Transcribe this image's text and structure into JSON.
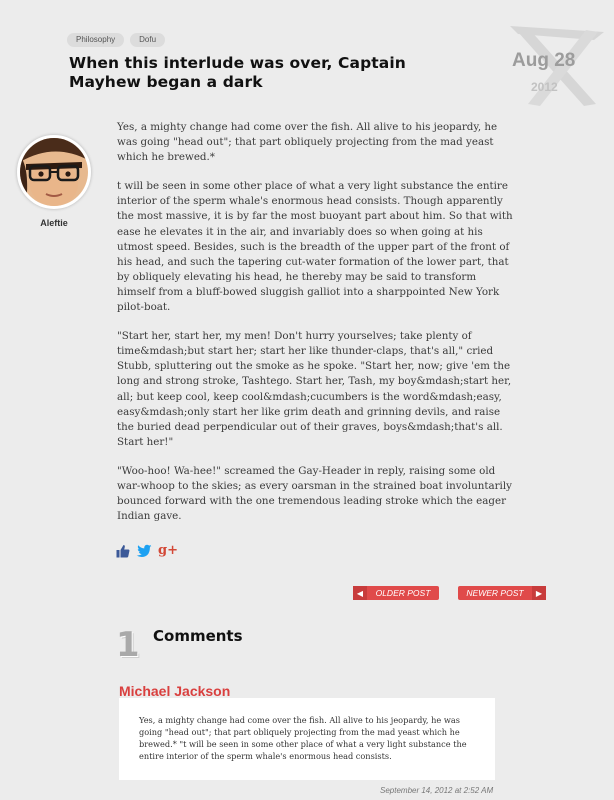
{
  "tags": [
    "Philosophy",
    "Dofu"
  ],
  "post": {
    "title": "When this interlude was over, Captain Mayhew began a dark",
    "date_day": "Aug 28",
    "date_year": "2012",
    "author": "Aleftie",
    "paragraphs": [
      "Yes, a mighty change had come over the fish. All alive to his jeopardy, he was going \"head out\"; that part obliquely projecting from the mad yeast which he brewed.*",
      "t will be seen in some other place of what a very light substance the entire interior of the sperm whale's enormous head consists. Though apparently the most massive, it is by far the most buoyant part about him. So that with ease he elevates it in the air, and invariably does so when going at his utmost speed. Besides, such is the breadth of the upper part of the front of his head, and such the tapering cut-water formation of the lower part, that by obliquely elevating his head, he thereby may be said to transform himself from a bluff-bowed sluggish galliot into a sharppointed New York pilot-boat.",
      "\"Start her, start her, my men! Don't hurry yourselves; take plenty of time&mdash;but start her; start her like thunder-claps, that's all,\" cried Stubb, spluttering out the smoke as he spoke. \"Start her, now; give 'em the long and strong stroke, Tashtego. Start her, Tash, my boy&mdash;start her, all; but keep cool, keep cool&mdash;cucumbers is the word&mdash;easy, easy&mdash;only start her like grim death and grinning devils, and raise the buried dead perpendicular out of their graves, boys&mdash;that's all. Start her!\"",
      "\"Woo-hoo! Wa-hee!\" screamed the Gay-Header in reply, raising some old war-whoop to the skies; as every oarsman in the strained boat involuntarily bounced forward with the one tremendous leading stroke which the eager Indian gave."
    ]
  },
  "share": {
    "icons": [
      "thumbs-up-icon",
      "twitter-icon",
      "google-plus-icon"
    ],
    "gplus_label": "g+"
  },
  "nav": {
    "older": "OLDER POST",
    "newer": "NEWER POST"
  },
  "comments": {
    "count": "1",
    "heading": "Comments",
    "items": [
      {
        "author": "Michael Jackson",
        "text": "Yes, a mighty change had come over the fish. All alive to his jeopardy, he was going \"head out\"; that part obliquely projecting from the mad yeast which he brewed.* \"t will be seen in some other place of what a very light substance the entire interior of the sperm whale's enormous head consists.",
        "date": "September 14, 2012 at 2:52 AM"
      }
    ]
  },
  "colors": {
    "accent": "#e04a4a",
    "comment_author": "#d9403f",
    "background": "#ececec"
  }
}
